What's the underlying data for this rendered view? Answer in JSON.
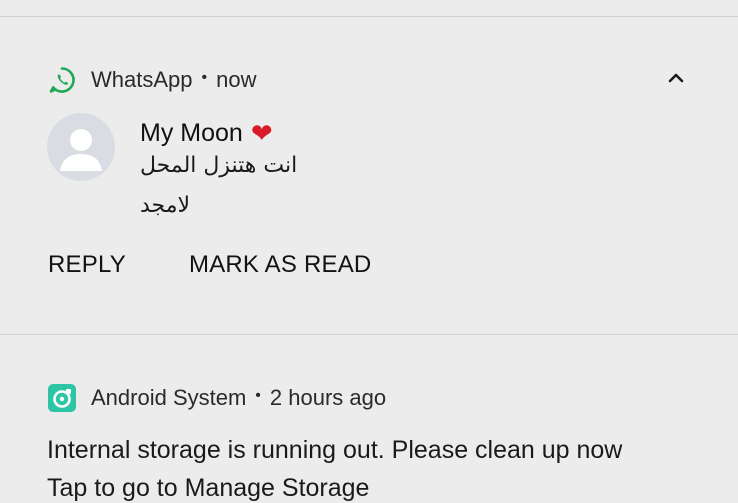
{
  "whatsapp_notification": {
    "app_name": "WhatsApp",
    "separator": "•",
    "time": "now",
    "app_icon": "whatsapp-icon",
    "expand_icon": "chevron-up-icon",
    "avatar_icon": "person-avatar-icon",
    "sender": "My Moon",
    "sender_emoji": "❤",
    "messages": [
      "انت هتنزل المحل",
      "لامجد"
    ],
    "actions": {
      "reply": "REPLY",
      "mark_as_read": "MARK AS READ"
    },
    "icon_color": "#1fa855"
  },
  "android_notification": {
    "app_name": "Android System",
    "separator": "•",
    "time": "2 hours ago",
    "app_icon": "storage-cleaner-icon",
    "title": "Internal storage is running out. Please clean up now",
    "text": "Tap to go to Manage Storage",
    "icon_color": "#2ec4a6"
  },
  "colors": {
    "background": "#ececec",
    "divider": "#cfcfcf",
    "heart": "#d81b2a"
  }
}
